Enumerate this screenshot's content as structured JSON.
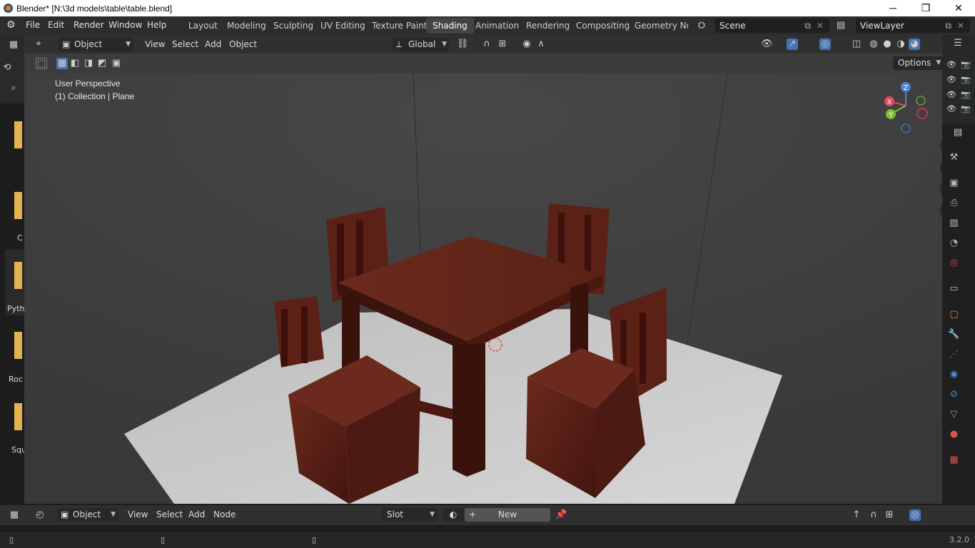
{
  "titlebar": {
    "title": "Blender* [N:\\3d models\\table\\table.blend]",
    "minimize": "─",
    "maximize": "❐",
    "close": "✕"
  },
  "menu": {
    "file": "File",
    "edit": "Edit",
    "render": "Render",
    "window": "Window",
    "help": "Help"
  },
  "workspaces": [
    "Layout",
    "Modeling",
    "Sculpting",
    "UV Editing",
    "Texture Paint",
    "Shading",
    "Animation",
    "Rendering",
    "Compositing",
    "Geometry Noc"
  ],
  "active_workspace": "Shading",
  "scene": {
    "name": "Scene"
  },
  "viewlayer": {
    "name": "ViewLayer"
  },
  "header3d": {
    "mode": "Object Mode",
    "view": "View",
    "select": "Select",
    "add": "Add",
    "object": "Object",
    "orientation": "Global"
  },
  "toolheader": {
    "options": "Options"
  },
  "viewport": {
    "perspective": "User Perspective",
    "collection": "(1) Collection | Plane"
  },
  "gizmo": {
    "x": "X",
    "y": "Y",
    "z": "Z"
  },
  "filebrowser_labels": [
    "C",
    "Pyth",
    "Roc",
    "Squ"
  ],
  "nodeheader": {
    "editor": "Object",
    "view": "View",
    "select": "Select",
    "add": "Add",
    "node": "Node",
    "slot": "Slot",
    "new": "New"
  },
  "statusbar": {
    "version": "3.2.0"
  },
  "colors": {
    "accent": "#4772b3",
    "wood": "#5a2016",
    "floor": "#c9c9c9",
    "viewport_bg": "#3d3d3d"
  }
}
